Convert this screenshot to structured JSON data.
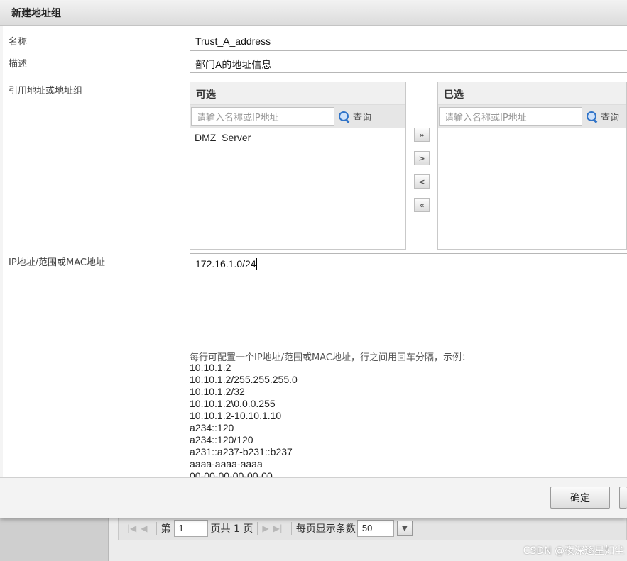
{
  "dialog": {
    "title": "新建地址组"
  },
  "form": {
    "name_label": "名称",
    "name_value": "Trust_A_address",
    "desc_label": "描述",
    "desc_value": "部门A的地址信息",
    "ref_label": "引用地址或地址组",
    "ip_label": "IP地址/范围或MAC地址",
    "ip_value": "172.16.1.0/24"
  },
  "available": {
    "header": "可选",
    "search_placeholder": "请输入名称或IP地址",
    "search_button": "查询",
    "items": [
      "DMZ_Server"
    ]
  },
  "selected": {
    "header": "已选",
    "search_placeholder": "请输入名称或IP地址",
    "search_button": "查询",
    "items": []
  },
  "transfer": {
    "add_all": "»",
    "add": ">",
    "remove": "<",
    "remove_all": "«"
  },
  "hint": {
    "text": "每行可配置一个IP地址/范围或MAC地址，行之间用回车分隔，示例：",
    "examples": [
      "10.10.1.2",
      "10.10.1.2/255.255.255.0",
      "10.10.1.2/32",
      "10.10.1.2\\0.0.0.255",
      "10.10.1.2-10.10.1.10",
      "a234::120",
      "a234::120/120",
      "a231::a237-b231::b237",
      "aaaa-aaaa-aaaa",
      "00-00-00-00-00-00"
    ]
  },
  "footer": {
    "ok": "确定"
  },
  "pager": {
    "page_prefix": "第",
    "page_value": "1",
    "page_suffix": "页共 1 页",
    "per_page_label": "每页显示条数",
    "per_page_value": "50"
  },
  "watermark": "CSDN @夜深逐星如尘"
}
